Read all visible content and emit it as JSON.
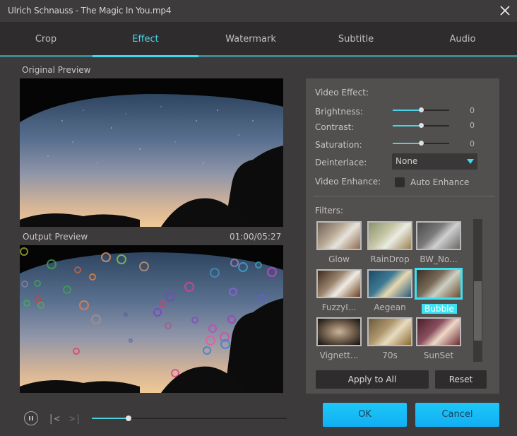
{
  "window": {
    "title": "Ulrich Schnauss - The Magic In You.mp4",
    "close_icon": "close-icon"
  },
  "tabs": [
    {
      "label": "Crop",
      "active": false
    },
    {
      "label": "Effect",
      "active": true
    },
    {
      "label": "Watermark",
      "active": false
    },
    {
      "label": "Subtitle",
      "active": false
    },
    {
      "label": "Audio",
      "active": false
    }
  ],
  "preview": {
    "original_label": "Original Preview",
    "output_label": "Output Preview",
    "time": "01:00/05:27"
  },
  "playback": {
    "pause_icon": "pause-icon",
    "prev_icon": "skip-previous-icon",
    "next_icon": "skip-next-icon",
    "progress_fraction": 0.19
  },
  "video_effect": {
    "heading": "Video Effect:",
    "sliders": [
      {
        "label": "Brightness:",
        "value": "0",
        "position_fraction": 0.5
      },
      {
        "label": "Contrast:",
        "value": "0",
        "position_fraction": 0.5
      },
      {
        "label": "Saturation:",
        "value": "0",
        "position_fraction": 0.5
      }
    ],
    "deinterlace": {
      "label": "Deinterlace:",
      "selected": "None"
    },
    "enhance": {
      "label": "Video Enhance:",
      "checkbox_label": "Auto Enhance",
      "checked": false
    }
  },
  "filters": {
    "heading": "Filters:",
    "items": [
      {
        "name": "Glow",
        "selected": false
      },
      {
        "name": "RainDrop",
        "selected": false
      },
      {
        "name": "BW_No...",
        "selected": false
      },
      {
        "name": "FuzzyI...",
        "selected": false
      },
      {
        "name": "Aegean",
        "selected": false
      },
      {
        "name": "Bubble",
        "selected": true
      },
      {
        "name": "Vignett...",
        "selected": false
      },
      {
        "name": "70s",
        "selected": false
      },
      {
        "name": "SunSet",
        "selected": false
      }
    ],
    "apply_all_label": "Apply to All",
    "reset_label": "Reset"
  },
  "footer": {
    "ok_label": "OK",
    "cancel_label": "Cancel"
  },
  "colors": {
    "accent": "#3fd9ec",
    "button_blue": "#1dc8f7",
    "panel": "#524f4f",
    "background": "#3d3a3b"
  }
}
